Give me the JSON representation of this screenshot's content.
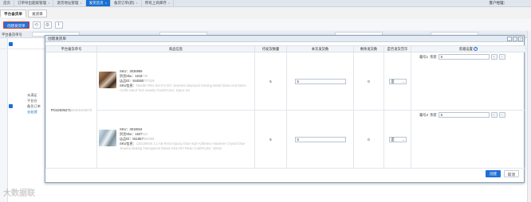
{
  "top_tabs": [
    {
      "label": "首页",
      "active": false
    },
    {
      "label": "订单导出超级管理",
      "active": false
    },
    {
      "label": "退货地址管理",
      "active": false
    },
    {
      "label": "发货首页",
      "active": true
    },
    {
      "label": "备货订单(新)",
      "active": false
    },
    {
      "label": "所有上商库存",
      "active": false
    }
  ],
  "user_label": "客户经理：",
  "sub_tabs": [
    {
      "label": "平台备货单",
      "active": true
    },
    {
      "label": "发货单",
      "active": false
    }
  ],
  "toolbar": {
    "create_label": "创建发货单"
  },
  "background": {
    "filter_label": "平台备货单号",
    "side_lines": [
      "未满足",
      "平台仓",
      "备货订单"
    ],
    "side_link": "去处理"
  },
  "modal": {
    "title": "创建发货单",
    "columns": [
      "平台备货单号",
      "商品信息",
      "待发货数量",
      "本次发货数",
      "剩余发货数",
      "是否发货完毕",
      "装箱设置"
    ],
    "order_no": "PO42505271",
    "order_no_blur": "06465466875",
    "rows": [
      {
        "sku_label": "SKU：3036959",
        "skc_label": "贸货Sku：1619",
        "skc_blur": "739",
        "store_label": "店品ID：844550",
        "store_blur": "707339",
        "desc_prefix": "SKU信息：",
        "desc_blur": "Needle Files Set For DIY Jewelers Diamond Carving Metal Glass And Stone Crafts Hand Tool Jewelry Tools#Color: 10pcs set",
        "pending_qty": "5",
        "ship_qty": "5",
        "remaining_qty": "0",
        "done_value": "是",
        "box_label": "箱号1 ",
        "box_type": "亲装",
        "box_qty": "5"
      },
      {
        "sku_label": "SKU：3018044",
        "skc_label": "贸货Sku：1527",
        "skc_blur": "622",
        "store_label": "店品ID：811957",
        "store_blur": "556669",
        "desc_prefix": "SKU信息：",
        "desc_blur": "1201096mt 1:1 AB Resin Epoxy Glue High Adhesive Hardener Crystal Glue Jewelry Making Transparent Mixed Glue DIY Resin Craft#Color: 100ml",
        "pending_qty": "5",
        "ship_qty": "5",
        "remaining_qty": "0",
        "done_value": "是",
        "box_label": "箱号2 ",
        "box_type": "亲装",
        "box_qty": "5"
      }
    ],
    "help_glyph": "?",
    "add_glyph": "+",
    "remove_glyph": "−",
    "confirm_label": "创建",
    "cancel_label": "取消"
  },
  "watermark": "大数据联"
}
